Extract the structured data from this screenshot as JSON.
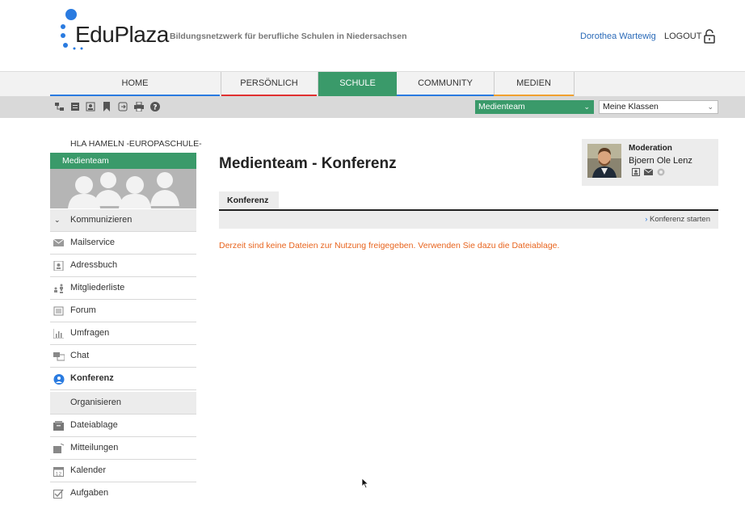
{
  "header": {
    "logo": "EduPlaza",
    "tagline": "Bildungsnetzwerk für berufliche Schulen in Niedersachsen",
    "user": "Dorothea Wartewig",
    "logout": "LOGOUT"
  },
  "nav": {
    "home": "HOME",
    "persoenlich": "PERSÖNLICH",
    "schule": "SCHULE",
    "community": "COMMUNITY",
    "medien": "MEDIEN"
  },
  "toolbar": {
    "team_select": "Medienteam",
    "klassen_select": "Meine Klassen"
  },
  "sidebar": {
    "school": "HLA HAMELN -EUROPASCHULE-",
    "team": "Medienteam",
    "kommunizieren": "Kommunizieren",
    "items": [
      "Mailservice",
      "Adressbuch",
      "Mitgliederliste",
      "Forum",
      "Umfragen",
      "Chat",
      "Konferenz"
    ],
    "organisieren": "Organisieren",
    "org_items": [
      "Dateiablage",
      "Mitteilungen",
      "Kalender",
      "Aufgaben"
    ]
  },
  "main": {
    "title": "Medienteam - Konferenz",
    "tab": "Konferenz",
    "start": "Konferenz starten",
    "message": "Derzeit sind keine Dateien zur Nutzung freigegeben. Verwenden Sie dazu die Dateiablage."
  },
  "moderation": {
    "title": "Moderation",
    "name": "Bjoern Ole Lenz"
  },
  "colors": {
    "green": "#3a9a6a",
    "blue_link": "#2a6ab8",
    "orange_msg": "#e8641e"
  }
}
